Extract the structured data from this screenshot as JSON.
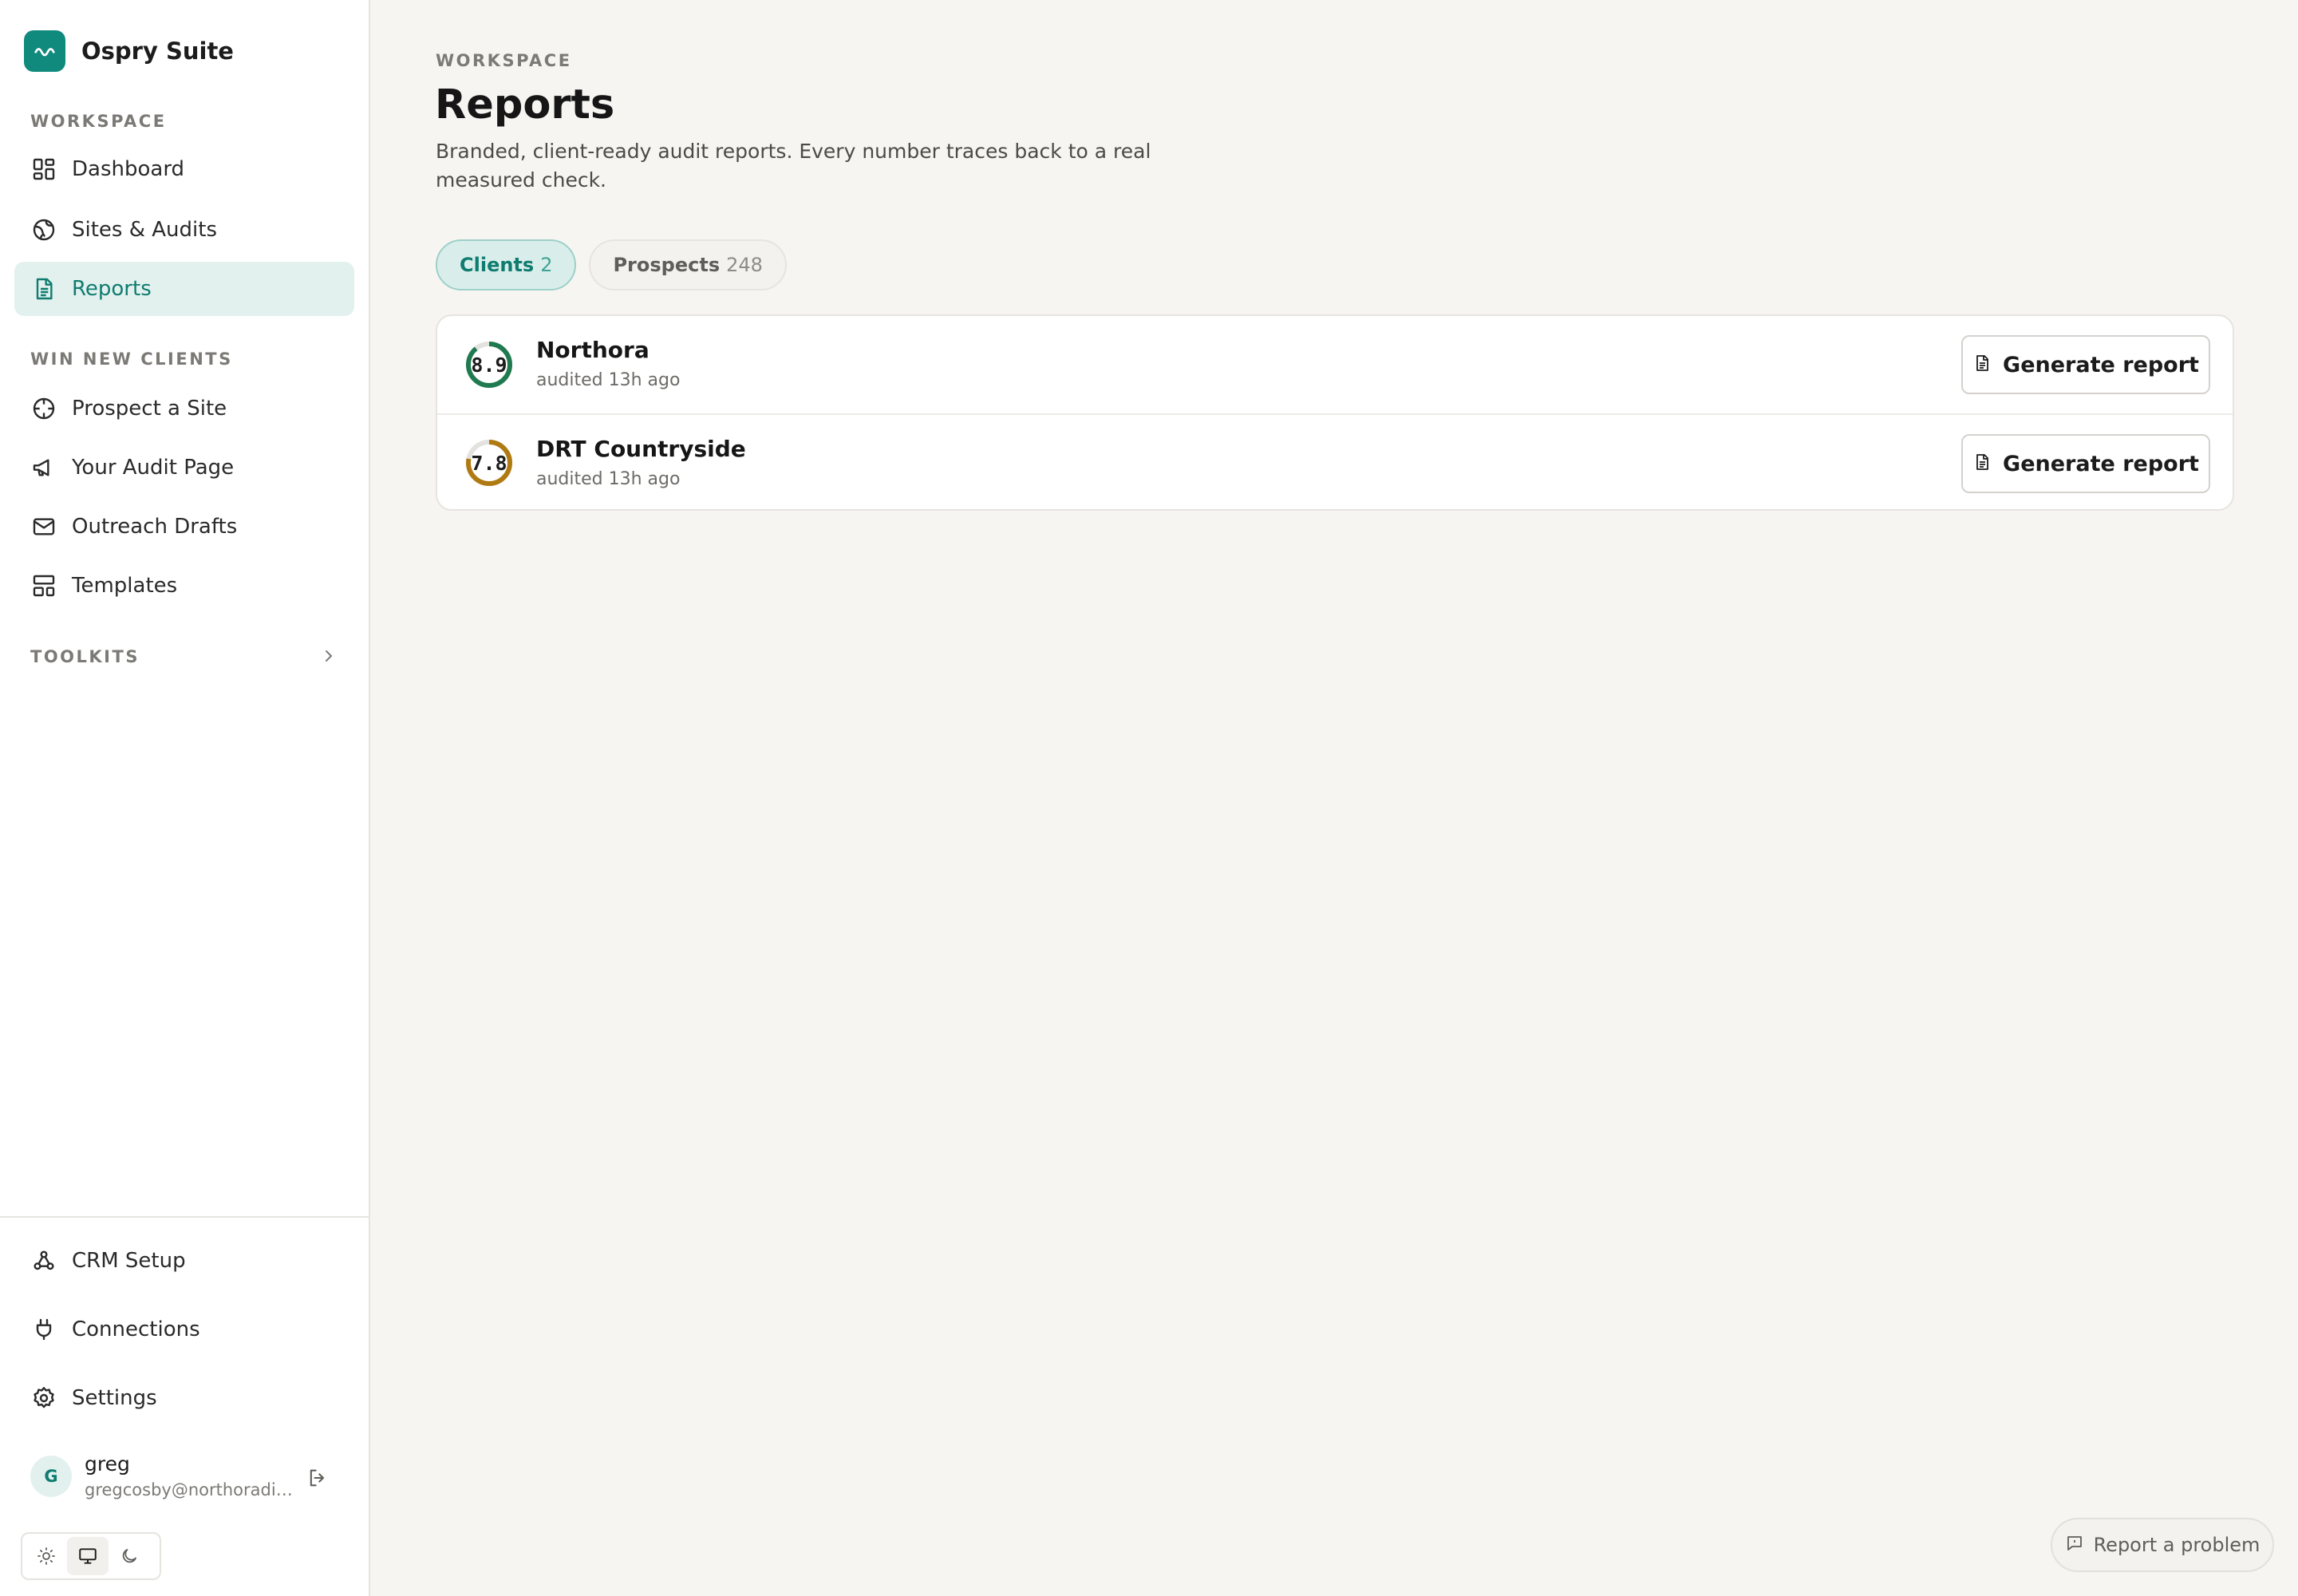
{
  "brand": {
    "name": "Ospry Suite",
    "icon": "wave-icon",
    "accent": "#0f8a7d"
  },
  "sidebar": {
    "sections": {
      "workspace": "WORKSPACE",
      "win_new_clients": "WIN NEW CLIENTS",
      "toolkits": "TOOLKITS"
    },
    "items": [
      {
        "label": "Dashboard",
        "icon": "dashboard-icon"
      },
      {
        "label": "Sites & Audits",
        "icon": "globe-icon"
      },
      {
        "label": "Reports",
        "icon": "document-icon",
        "active": true
      },
      {
        "label": "Prospect a Site",
        "icon": "crosshair-icon"
      },
      {
        "label": "Your Audit Page",
        "icon": "megaphone-icon"
      },
      {
        "label": "Outreach Drafts",
        "icon": "mail-icon"
      },
      {
        "label": "Templates",
        "icon": "layout-icon"
      }
    ],
    "bottom_items": [
      {
        "label": "CRM Setup",
        "icon": "webhook-icon"
      },
      {
        "label": "Connections",
        "icon": "plug-icon"
      },
      {
        "label": "Settings",
        "icon": "gear-icon"
      }
    ],
    "user": {
      "initial": "G",
      "name": "greg",
      "email": "gregcosby@northoradigi..."
    },
    "theme": {
      "selected": "system",
      "options": [
        "light",
        "system",
        "dark"
      ]
    }
  },
  "main": {
    "eyebrow": "WORKSPACE",
    "title": "Reports",
    "description": "Branded, client-ready audit reports. Every number traces back to a real measured check.",
    "tabs": [
      {
        "label": "Clients",
        "count": "2",
        "active": true
      },
      {
        "label": "Prospects",
        "count": "248",
        "active": false
      }
    ],
    "rows": [
      {
        "score": "8.9",
        "score_value": 0.89,
        "score_color": "#1f7a4f",
        "name": "Northora",
        "subtitle": "audited 13h ago",
        "action": "Generate report"
      },
      {
        "score": "7.8",
        "score_value": 0.78,
        "score_color": "#b07a12",
        "name": "DRT Countryside",
        "subtitle": "audited 13h ago",
        "action": "Generate report"
      }
    ],
    "report_problem": "Report a problem"
  }
}
